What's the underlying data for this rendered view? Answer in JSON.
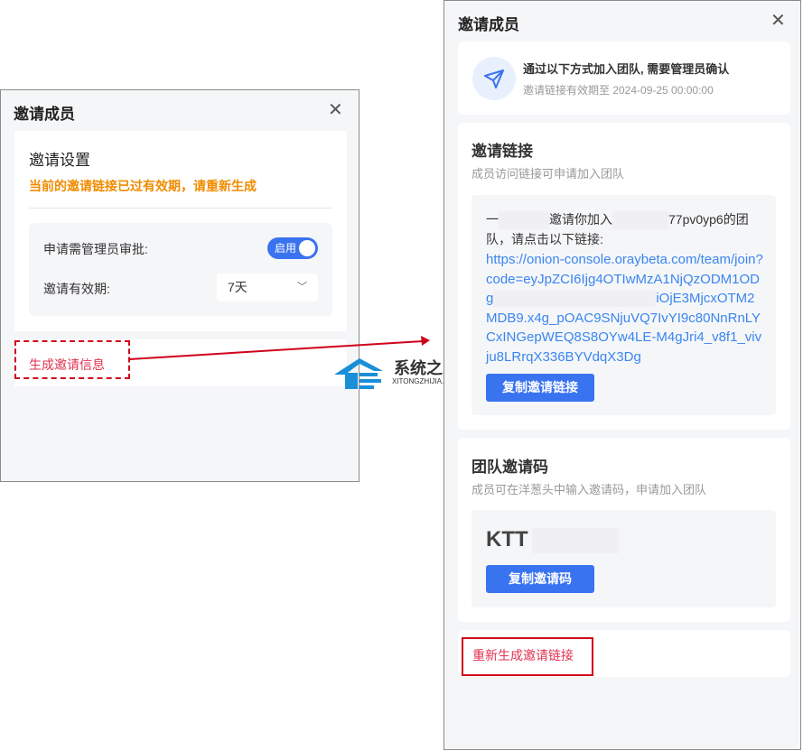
{
  "left_dialog": {
    "title": "邀请成员",
    "settings_title": "邀请设置",
    "warning": "当前的邀请链接已过有效期，请重新生成",
    "approval_label": "申请需管理员审批:",
    "approval_toggle": "启用",
    "validity_label": "邀请有效期:",
    "validity_value": "7天",
    "generate_link": "生成邀请信息"
  },
  "right_dialog": {
    "title": "邀请成员",
    "notice_title": "通过以下方式加入团队, 需要管理员确认",
    "notice_sub": "邀请链接有效期至 2024-09-25 00:00:00",
    "link_section": {
      "title": "邀请链接",
      "subtitle": "成员访问链接可申请加入团队",
      "msg_prefix": "一",
      "msg_mid": "邀请你加入",
      "msg_suffix": "77pv0yp6的团队，请点击以下链接:",
      "url_part1": "https://onion-console.oraybeta.com/team/join?code=eyJpZCI6Ijg4OTIwMzA1NjQzODM1ODg",
      "url_part2": "iOjE3MjcxOTM2MDB9.x4g_pOAC9SNjuVQ7IvYI9c80NnRnLYCxINGepWEQ8S8OYw4LE-M4gJri4_v8f1_vivju8LRrqX336BYVdqX3Dg",
      "copy_button": "复制邀请链接"
    },
    "code_section": {
      "title": "团队邀请码",
      "subtitle": "成员可在洋葱头中输入邀请码，申请加入团队",
      "code": "KTT",
      "copy_button": "复制邀请码"
    },
    "regenerate_link": "重新生成邀请链接"
  },
  "watermark": {
    "name": "系统之家",
    "domain": "XITONGZHIJIA.NET"
  },
  "colors": {
    "accent": "#3a73f0",
    "warning": "#f08c00",
    "danger": "#e0334f",
    "annotation": "#d0021b"
  }
}
